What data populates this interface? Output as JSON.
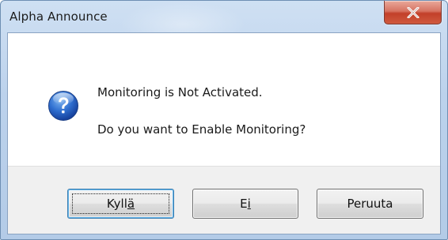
{
  "window": {
    "title": "Alpha Announce",
    "close_icon": "close-icon"
  },
  "message": {
    "icon": "question-icon",
    "line1": "Monitoring is Not Activated.",
    "line2": "Do you want to Enable Monitoring?"
  },
  "buttons": {
    "yes": {
      "prefix": "Kyll",
      "accel": "ä",
      "suffix": ""
    },
    "no": {
      "prefix": "E",
      "accel": "i",
      "suffix": ""
    },
    "cancel": {
      "label": "Peruuta"
    }
  },
  "colors": {
    "close_button": "#c2402a",
    "default_button_border": "#3c7fb1",
    "button_area": "#f0f0f0"
  }
}
